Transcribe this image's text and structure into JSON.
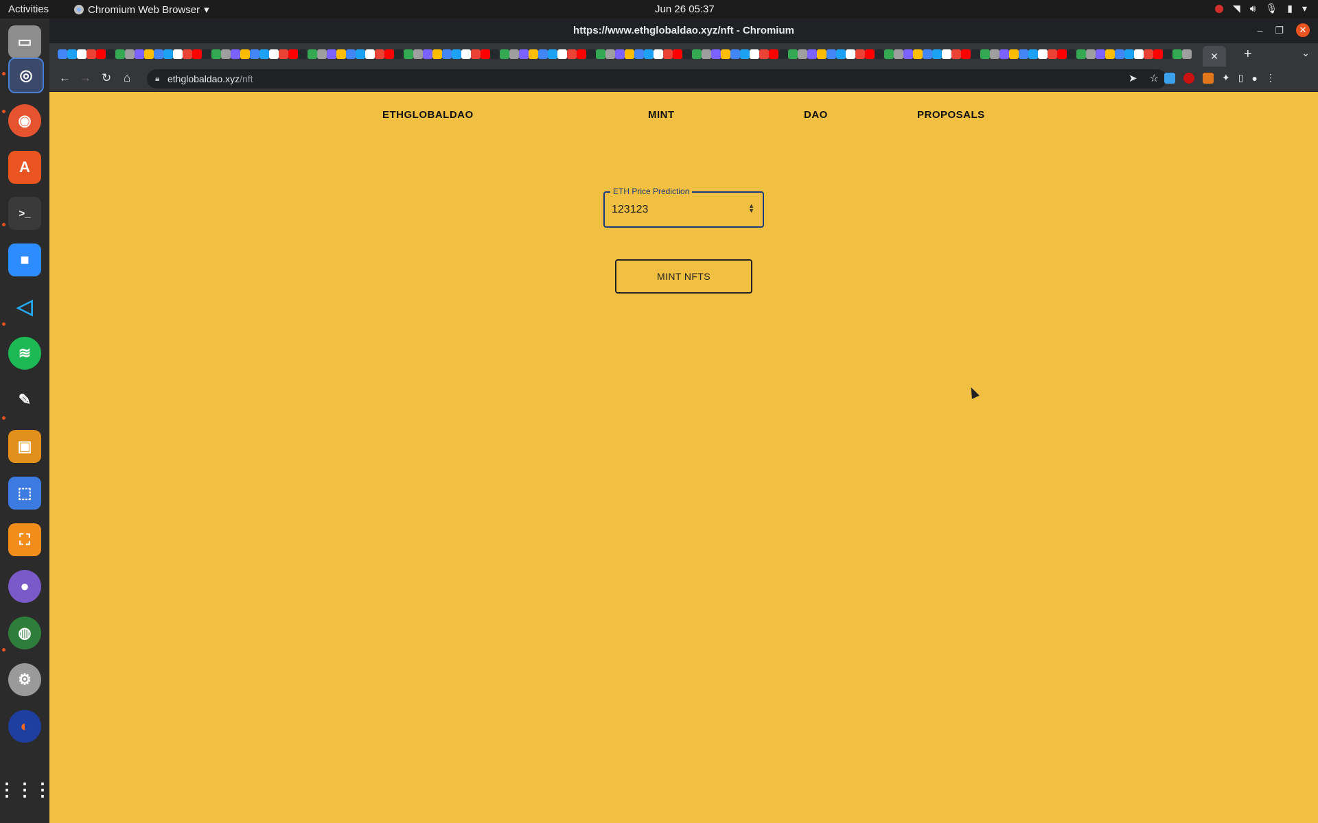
{
  "topbar": {
    "activities": "Activities",
    "app_name": "Chromium Web Browser",
    "clock": "Jun 26  05:37"
  },
  "window": {
    "title": "https://www.ethglobaldao.xyz/nft - Chromium"
  },
  "omnibox": {
    "host": "ethglobaldao.xyz",
    "path": "/nft"
  },
  "page": {
    "nav": {
      "brand": "ETHGLOBALDAO",
      "mint": "MINT",
      "dao": "DAO",
      "proposals": "PROPOSALS"
    },
    "prediction_field": {
      "label": "ETH Price Prediction",
      "value": "123123"
    },
    "mint_button": "MINT NFTS"
  },
  "colors": {
    "page_background": "#f1bf42",
    "field_border": "#1a3a7a"
  },
  "icons": {
    "toolbar": [
      "back-icon",
      "forward-icon",
      "reload-icon",
      "home-icon",
      "lock-icon",
      "send-icon",
      "bookmark-star-icon",
      "extensions-icon",
      "side-panel-icon",
      "profile-icon",
      "menu-icon"
    ],
    "dock": [
      "files-icon",
      "chromium-icon",
      "firefox-icon",
      "app-store-icon",
      "terminal-icon",
      "zoom-icon",
      "vscode-icon",
      "spotify-icon",
      "inkscape-icon",
      "image-viewer-icon",
      "screenshot-icon",
      "screen-recorder-icon",
      "camera-icon",
      "globe-icon",
      "settings-icon",
      "audacity-icon",
      "app-grid-icon"
    ]
  }
}
